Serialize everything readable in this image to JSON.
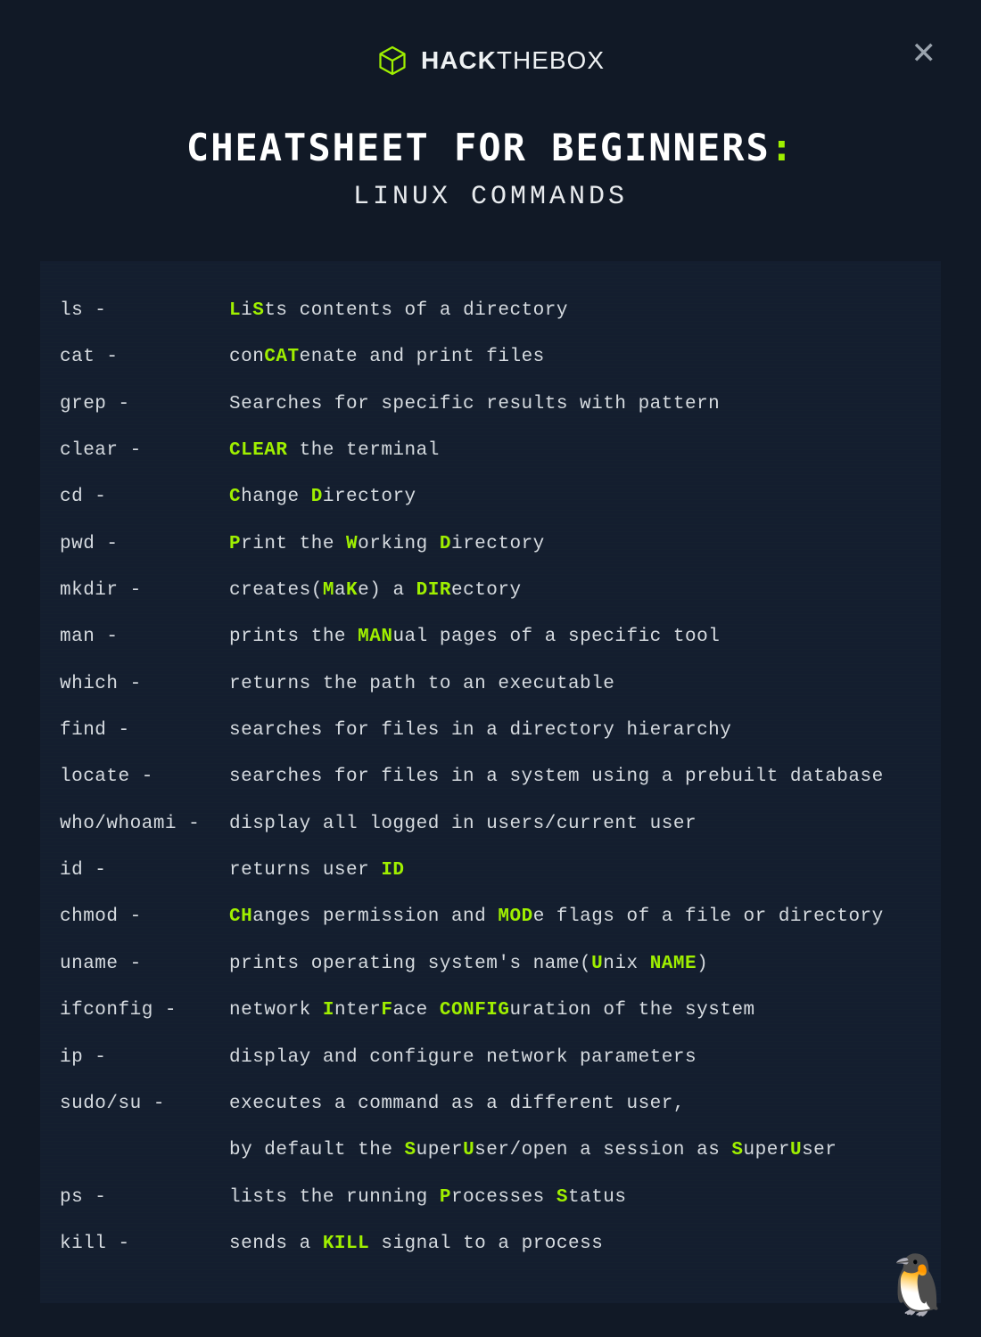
{
  "brand": {
    "bold": "HACK",
    "rest": "THEBOX"
  },
  "title": "CHEATSHEET FOR BEGINNERS",
  "subtitle": "LINUX COMMANDS",
  "accent": "#9fef00",
  "commands": [
    {
      "cmd": "ls -",
      "desc": "<b>L</b>i<b>S</b>ts contents of a directory"
    },
    {
      "cmd": "cat -",
      "desc": "con<b>CAT</b>enate and print files"
    },
    {
      "cmd": "grep -",
      "desc": "Searches for specific results with pattern"
    },
    {
      "cmd": "clear -",
      "desc": "<b>CLEAR</b> the terminal"
    },
    {
      "cmd": "cd -",
      "desc": "<b>C</b>hange <b>D</b>irectory"
    },
    {
      "cmd": "pwd -",
      "desc": "<b>P</b>rint the <b>W</b>orking <b>D</b>irectory"
    },
    {
      "cmd": "mkdir -",
      "desc": "creates(<b>M</b>a<b>K</b>e) a <b>DIR</b>ectory"
    },
    {
      "cmd": "man -",
      "desc": "prints the <b>MAN</b>ual pages of a specific tool"
    },
    {
      "cmd": "which -",
      "desc": "returns the path to an executable"
    },
    {
      "cmd": "find -",
      "desc": "searches for files in a directory hierarchy"
    },
    {
      "cmd": "locate -",
      "desc": "searches for files in a system using a prebuilt database"
    },
    {
      "cmd": "who/whoami -",
      "desc": "display all logged in users/current user"
    },
    {
      "cmd": "id -",
      "desc": "returns user <b>ID</b>"
    },
    {
      "cmd": "chmod -",
      "desc": "<b>CH</b>anges permission and <b>MOD</b>e flags of a file or directory"
    },
    {
      "cmd": "uname -",
      "desc": "prints operating system's name(<b>U</b>nix <b>NAME</b>)"
    },
    {
      "cmd": "ifconfig -",
      "desc": "network <b>I</b>nter<b>F</b>ace <b>CONFIG</b>uration of the system"
    },
    {
      "cmd": "ip -",
      "desc": "display and configure network parameters"
    },
    {
      "cmd": "sudo/su -",
      "desc": "executes a command as a different user,"
    },
    {
      "cmd": "",
      "desc": "by default the <b>S</b>uper<b>U</b>ser/open a session as <b>S</b>uper<b>U</b>ser",
      "cont": true
    },
    {
      "cmd": "ps -",
      "desc": "lists the running <b>P</b>rocesses <b>S</b>tatus"
    },
    {
      "cmd": "kill -",
      "desc": "sends a <b>KILL</b> signal to a process"
    }
  ],
  "icons": {
    "tux": "🐧",
    "close": "✕"
  }
}
